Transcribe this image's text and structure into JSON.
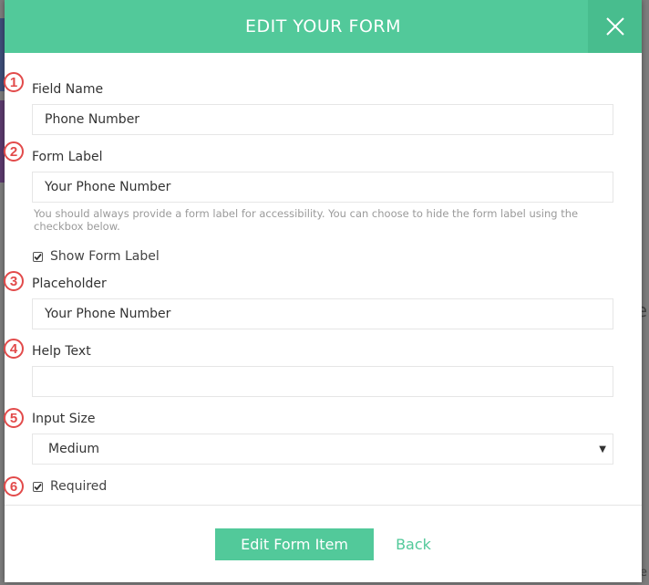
{
  "modal": {
    "title": "EDIT YOUR FORM",
    "accent_color": "#52c99a",
    "close_icon": "close-icon"
  },
  "fields": {
    "field_name": {
      "number": "1",
      "label": "Field Name",
      "value": "Phone Number"
    },
    "form_label": {
      "number": "2",
      "label": "Form Label",
      "value": "Your Phone Number",
      "note": "You should always provide a form label for accessibility. You can choose to hide the form label using the checkbox below."
    },
    "show_form_label": {
      "label": "Show Form Label",
      "checked": true
    },
    "placeholder": {
      "number": "3",
      "label": "Placeholder",
      "value": "Your Phone Number"
    },
    "help_text": {
      "number": "4",
      "label": "Help Text",
      "value": ""
    },
    "input_size": {
      "number": "5",
      "label": "Input Size",
      "value": "Medium"
    },
    "required": {
      "number": "6",
      "label": "Required",
      "checked": true
    }
  },
  "footer": {
    "edit_button": "Edit Form Item",
    "back_link": "Back"
  },
  "background": {
    "right_char": "e",
    "bottom_char": "re"
  }
}
